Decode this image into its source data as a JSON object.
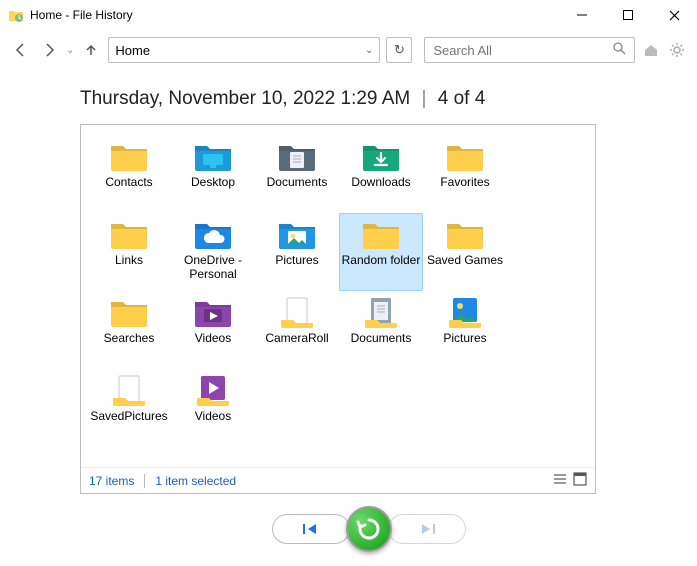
{
  "window": {
    "title": "Home - File History"
  },
  "nav": {
    "address": "Home",
    "search_placeholder": "Search All"
  },
  "header": {
    "datetime": "Thursday, November 10, 2022 1:29 AM",
    "separator": "|",
    "position": "4 of 4"
  },
  "items": [
    {
      "label": "Contacts",
      "kind": "folder-yellow"
    },
    {
      "label": "Desktop",
      "kind": "folder-desktop"
    },
    {
      "label": "Documents",
      "kind": "folder-documents"
    },
    {
      "label": "Downloads",
      "kind": "folder-downloads"
    },
    {
      "label": "Favorites",
      "kind": "folder-yellow"
    },
    {
      "label": "Links",
      "kind": "folder-yellow"
    },
    {
      "label": "OneDrive - Personal",
      "kind": "folder-onedrive"
    },
    {
      "label": "Pictures",
      "kind": "folder-pictures"
    },
    {
      "label": "Random folder",
      "kind": "folder-yellow",
      "selected": true
    },
    {
      "label": "Saved Games",
      "kind": "folder-yellow"
    },
    {
      "label": "Searches",
      "kind": "folder-yellow"
    },
    {
      "label": "Videos",
      "kind": "folder-videos"
    },
    {
      "label": "CameraRoll",
      "kind": "library"
    },
    {
      "label": "Documents",
      "kind": "library-doc"
    },
    {
      "label": "Pictures",
      "kind": "library-pic"
    },
    {
      "label": "SavedPictures",
      "kind": "library"
    },
    {
      "label": "Videos",
      "kind": "library-vid"
    }
  ],
  "status": {
    "count": "17 items",
    "selected": "1 item selected"
  }
}
